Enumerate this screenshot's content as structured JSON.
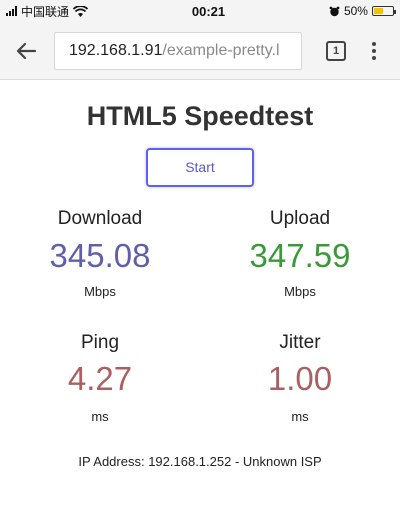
{
  "status_bar": {
    "carrier": "中国联通",
    "time": "00:21",
    "battery_percent_text": "50%",
    "battery_level": 0.5
  },
  "browser": {
    "url_host": "192.168.1.91",
    "url_path": "/example-pretty.l",
    "tab_count": "1"
  },
  "page": {
    "title": "HTML5 Speedtest",
    "start_label": "Start",
    "download": {
      "label": "Download",
      "value": "345.08",
      "unit": "Mbps",
      "color": "#6060aa"
    },
    "upload": {
      "label": "Upload",
      "value": "347.59",
      "unit": "Mbps",
      "color": "#3a9a3a"
    },
    "ping": {
      "label": "Ping",
      "value": "4.27",
      "unit": "ms",
      "color": "#aa6060"
    },
    "jitter": {
      "label": "Jitter",
      "value": "1.00",
      "unit": "ms",
      "color": "#aa6060"
    },
    "ip_info": "IP Address: 192.168.1.252 - Unknown ISP"
  },
  "colors": {
    "accent": "#6060ee"
  }
}
